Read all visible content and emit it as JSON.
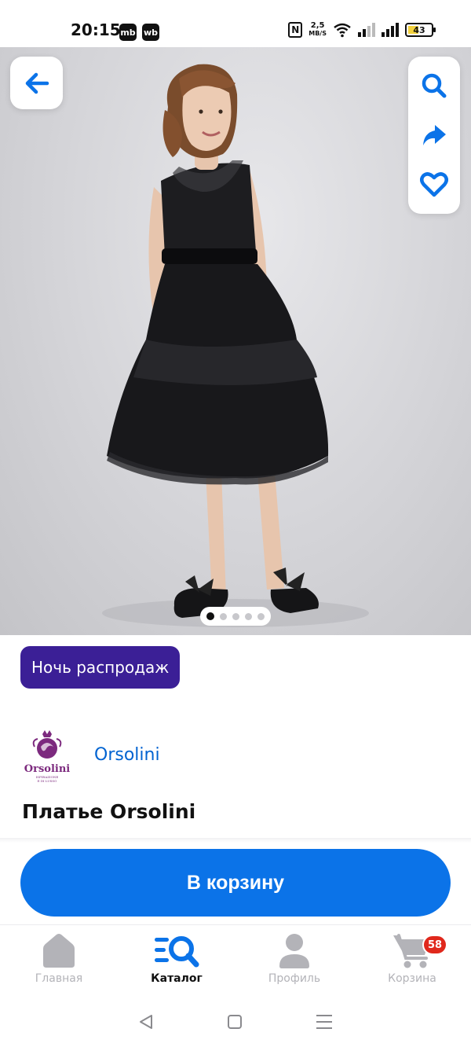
{
  "status_bar": {
    "time": "20:15",
    "app_icons": [
      "mb",
      "wb"
    ],
    "nfc": "N",
    "speed_value": "2,5",
    "speed_unit": "MB/S",
    "battery": "43"
  },
  "gallery": {
    "image_index": 0,
    "image_count": 5
  },
  "sale_badge": "Ночь распродаж",
  "brand": {
    "logo_text": "Orsolini",
    "logo_tagline": "ISPIRAZIONE E DI LUSSO",
    "name": "Orsolini"
  },
  "product": {
    "title": "Платье Orsolini"
  },
  "add_to_cart": "В корзину",
  "bottom_nav": {
    "items": [
      {
        "label": "Главная",
        "icon": "home-icon"
      },
      {
        "label": "Каталог",
        "icon": "catalog-search-icon"
      },
      {
        "label": "Профиль",
        "icon": "profile-icon"
      },
      {
        "label": "Корзина",
        "icon": "cart-icon"
      }
    ],
    "cart_badge": "58",
    "active": "Каталог"
  },
  "colors": {
    "accent": "#0b73e8",
    "brand_link": "#0063d1",
    "sale_badge": "#3b1f96",
    "cart_badge": "#e0281c"
  }
}
